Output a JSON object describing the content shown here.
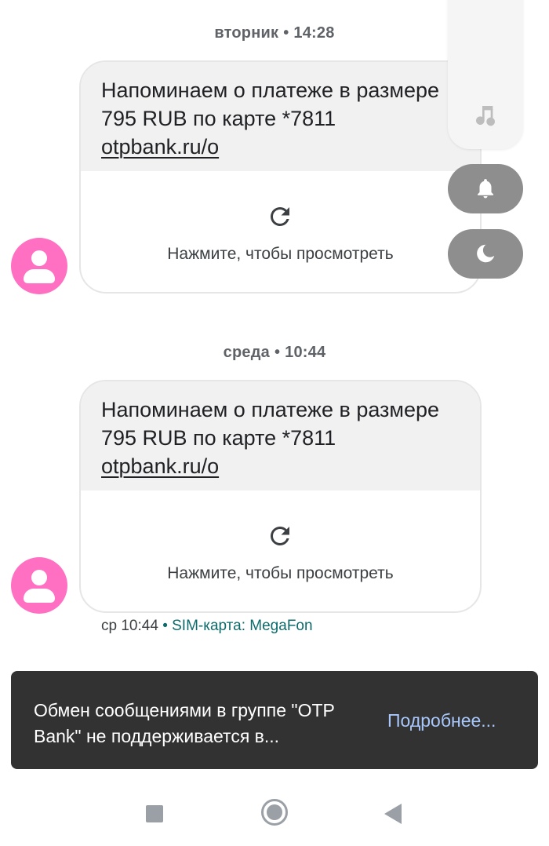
{
  "conversation": {
    "messages": [
      {
        "date_day": "вторник",
        "date_time": "14:28",
        "text": "Напоминаем о платеже в размере 795 RUB по карте *7811",
        "link": "otpbank.ru/o",
        "preview_hint": "Нажмите, чтобы просмотреть"
      },
      {
        "date_day": "среда",
        "date_time": "10:44",
        "text": "Напоминаем о платеже в размере 795 RUB по карте *7811",
        "link": "otpbank.ru/o",
        "preview_hint": "Нажмите, чтобы просмотреть",
        "meta_time": "ср 10:44",
        "meta_sim": "SIM-карта: MegaFon"
      }
    ],
    "date_separator_dot": "•"
  },
  "volume_panel": {
    "icons": [
      "music-note-icon",
      "bell-icon",
      "moon-icon"
    ],
    "pill_color": "#8e8e8e"
  },
  "snackbar": {
    "message": "Обмен сообщениями в группе \"OTP Bank\" не поддерживается в...",
    "action": "Подробнее..."
  },
  "navbar": {
    "icons": [
      "recents-icon",
      "home-icon",
      "back-icon"
    ]
  },
  "colors": {
    "avatar": "#ff6fc2",
    "snackbar_bg": "#323232",
    "snackbar_action": "#a8c7fa",
    "sim_label": "#0d6b6b"
  }
}
